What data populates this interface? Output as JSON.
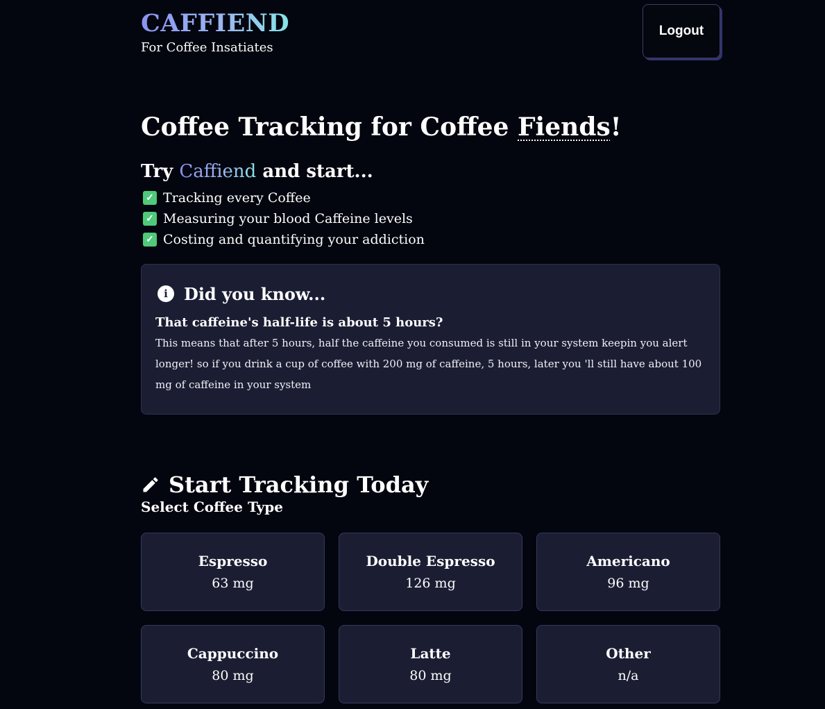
{
  "header": {
    "brand": "CAFFIEND",
    "tagline": "For Coffee Insatiates",
    "logout_label": "Logout"
  },
  "hero": {
    "title_prefix": "Coffee Tracking for Coffee ",
    "title_highlight": "Fiends",
    "title_suffix": "!",
    "try_prefix": "Try ",
    "try_brand": "Caffiend",
    "try_suffix": " and start...",
    "features": [
      "Tracking every Coffee",
      "Measuring your blood Caffeine levels",
      "Costing and quantifying your addiction"
    ],
    "check_icon": "check-box-icon",
    "check_color": "#4fc97a"
  },
  "info": {
    "icon": "info-circle-icon",
    "heading": "Did you know...",
    "question": "That caffeine's half-life is about 5 hours?",
    "body": "This means that after 5 hours, half the caffeine you consumed is still in your system keepin you alert longer! so if you drink a cup of coffee with 200 mg of caffeine, 5 hours, later you 'll still have about 100 mg of caffeine in your system"
  },
  "tracking": {
    "icon": "pencil-icon",
    "heading": "Start Tracking Today",
    "select_label": "Select Coffee Type",
    "coffees": [
      {
        "name": "Espresso",
        "amount": "63 mg"
      },
      {
        "name": "Double Espresso",
        "amount": "126 mg"
      },
      {
        "name": "Americano",
        "amount": "96 mg"
      },
      {
        "name": "Cappuccino",
        "amount": "80 mg"
      },
      {
        "name": "Latte",
        "amount": "80 mg"
      },
      {
        "name": "Other",
        "amount": "n/a"
      }
    ]
  },
  "colors": {
    "background": "#04060f",
    "card": "#1b1e33",
    "brand_gradient_start": "#8a93f2",
    "brand_gradient_end": "#86e6e6"
  }
}
